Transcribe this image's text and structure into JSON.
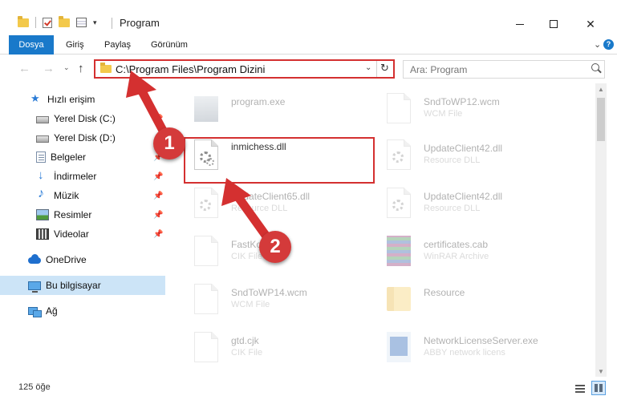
{
  "window": {
    "title": "Program",
    "min_label": "—",
    "close_label": "✕"
  },
  "ribbon": {
    "tabs": [
      "Dosya",
      "Giriş",
      "Paylaş",
      "Görünüm"
    ],
    "expand_glyph": "⌄",
    "help_glyph": "?"
  },
  "nav": {
    "back_glyph": "←",
    "forward_glyph": "→",
    "recent_glyph": "⌄",
    "up_glyph": "↑",
    "address": "C:\\Program Files\\Program Dizini",
    "address_drop": "⌄",
    "refresh_glyph": "↻",
    "search_placeholder": "Ara: Program"
  },
  "sidebar": {
    "items": [
      {
        "label": "Hızlı erişim",
        "icon": "star-icon",
        "pinned": false
      },
      {
        "label": "Yerel Disk (C:)",
        "icon": "drive-icon",
        "pinned": true
      },
      {
        "label": "Yerel Disk (D:)",
        "icon": "drive-icon",
        "pinned": true
      },
      {
        "label": "Belgeler",
        "icon": "documents-icon",
        "pinned": true
      },
      {
        "label": "İndirmeler",
        "icon": "downloads-icon",
        "pinned": true
      },
      {
        "label": "Müzik",
        "icon": "music-icon",
        "pinned": true
      },
      {
        "label": "Resimler",
        "icon": "pictures-icon",
        "pinned": true
      },
      {
        "label": "Videolar",
        "icon": "videos-icon",
        "pinned": true
      },
      {
        "label": "OneDrive",
        "icon": "onedrive-icon",
        "pinned": false
      },
      {
        "label": "Bu bilgisayar",
        "icon": "this-pc-icon",
        "pinned": false,
        "selected": true
      },
      {
        "label": "Ağ",
        "icon": "network-icon",
        "pinned": false
      }
    ],
    "pin_glyph": "📌"
  },
  "files": [
    {
      "name": "program.exe",
      "type": "",
      "kind": "exe",
      "dim": true
    },
    {
      "name": "SndToWP12.wcm",
      "type": "WCM File",
      "kind": "doc",
      "dim": true
    },
    {
      "name": "inmichess.dll",
      "type": "",
      "kind": "dll",
      "dim": false,
      "highlighted": true
    },
    {
      "name": "UpdateClient42.dll",
      "type": "Resource DLL",
      "kind": "dll",
      "dim": true
    },
    {
      "name": "UpdateClient65.dll",
      "type": "Resource DLL",
      "kind": "dll",
      "dim": true
    },
    {
      "name": "UpdateClient42.dll",
      "type": "Resource DLL",
      "kind": "dll",
      "dim": true
    },
    {
      "name": "FastKor",
      "type": "CIK File",
      "kind": "doc",
      "dim": true
    },
    {
      "name": "certificates.cab",
      "type": "WinRAR Archive",
      "kind": "rar",
      "dim": true
    },
    {
      "name": "SndToWP14.wcm",
      "type": "WCM File",
      "kind": "doc",
      "dim": true
    },
    {
      "name": "Resource",
      "type": "",
      "kind": "folder",
      "dim": true
    },
    {
      "name": "gtd.cjk",
      "type": "CIK File",
      "kind": "doc",
      "dim": true
    },
    {
      "name": "NetworkLicenseServer.exe",
      "type": "ABBY network licens",
      "kind": "net",
      "dim": true
    }
  ],
  "status": {
    "count": "125 öğe"
  },
  "annotations": {
    "badge_1": "1",
    "badge_2": "2",
    "color": "#d43030"
  }
}
